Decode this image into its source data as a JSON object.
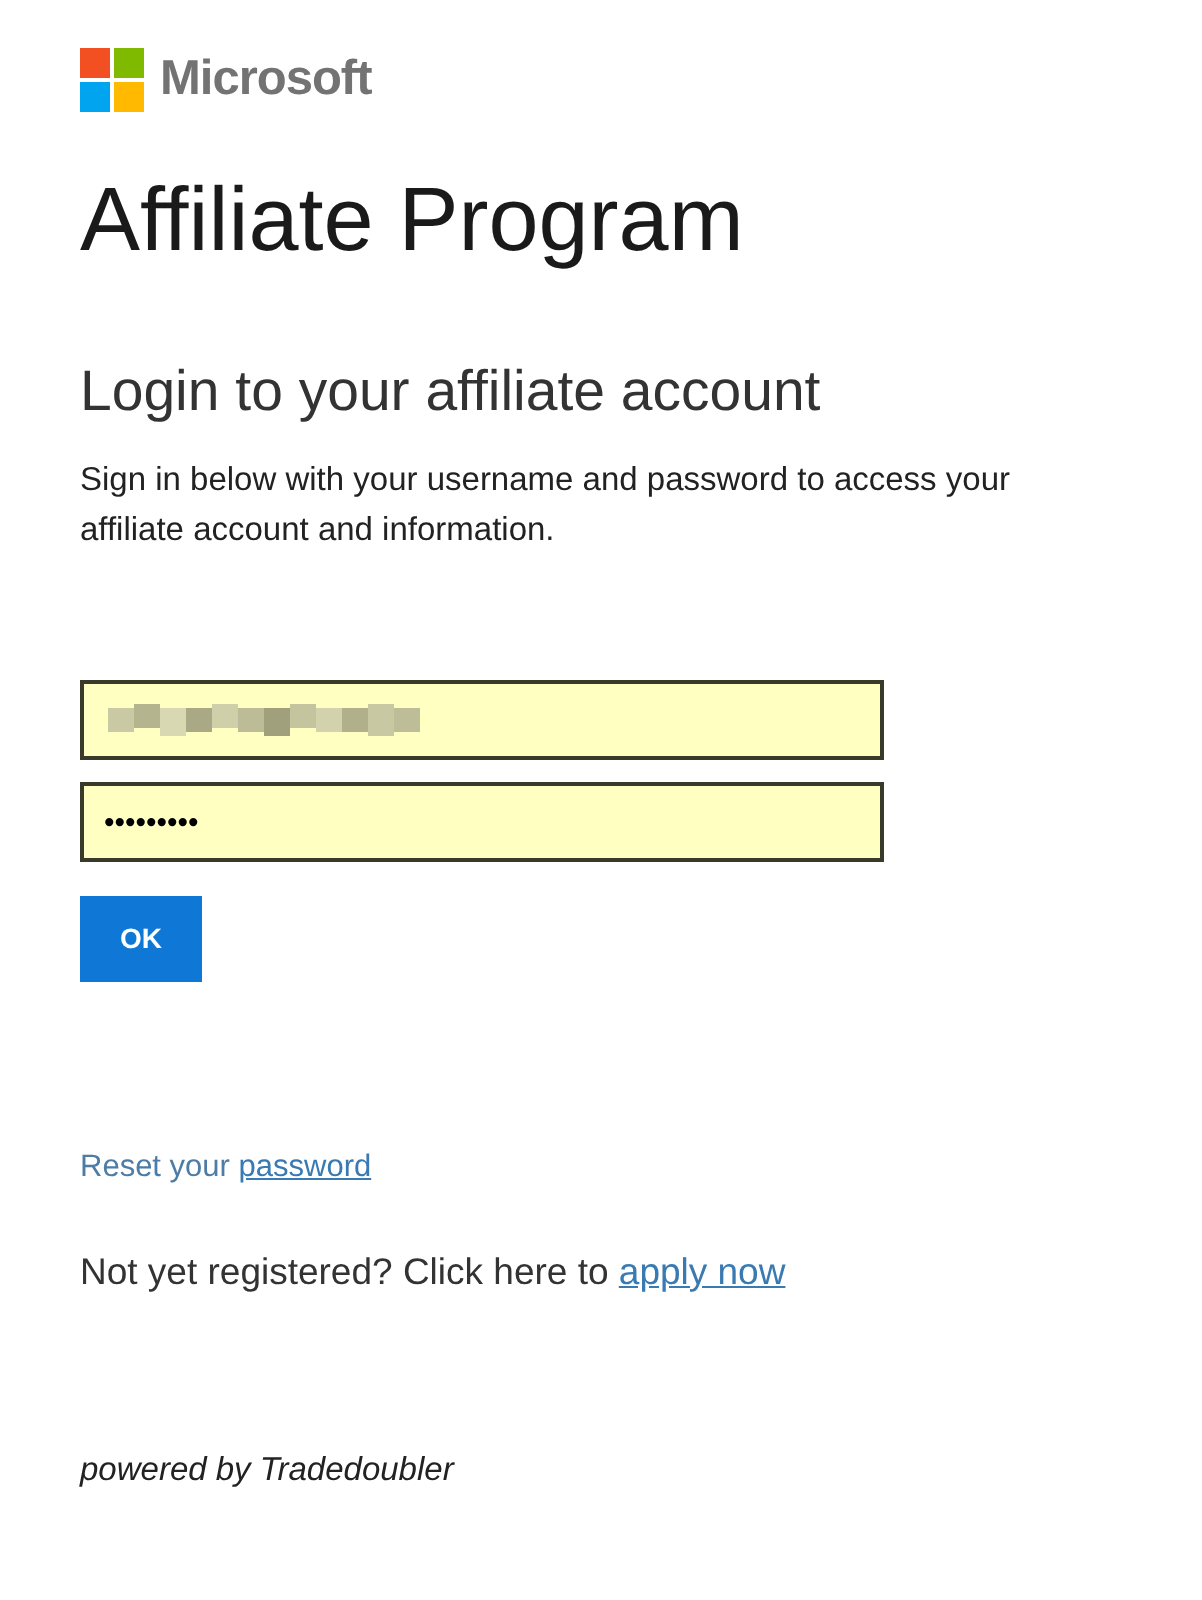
{
  "logo": {
    "brand": "Microsoft"
  },
  "title": "Affiliate Program",
  "form": {
    "heading": "Login to your affiliate account",
    "intro": "Sign in below with your username and password to access your affiliate account and information.",
    "username": {
      "redacted": true
    },
    "password": {
      "value": "•••••••••"
    },
    "submit": "OK"
  },
  "links": [
    {
      "kind": "help",
      "text": "Reset your ",
      "link": "password"
    },
    {
      "kind": "prompt",
      "text": "Not yet registered? Click here to ",
      "link": "apply now"
    }
  ],
  "footer": "powered by Tradedoubler"
}
